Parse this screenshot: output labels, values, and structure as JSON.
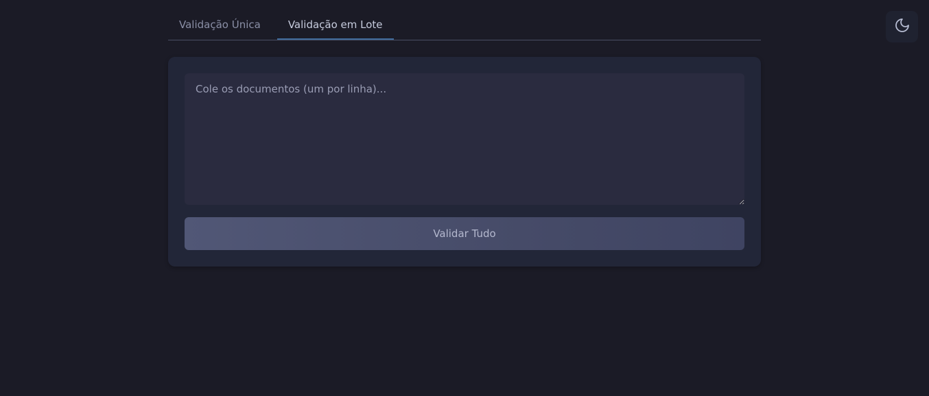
{
  "tabs": [
    {
      "label": "Validação Única",
      "active": false
    },
    {
      "label": "Validação em Lote",
      "active": true
    }
  ],
  "batch": {
    "placeholder": "Cole os documentos (um por linha)...",
    "value": "",
    "button_label": "Validar Tudo"
  },
  "theme_toggle": {
    "icon": "moon-icon"
  },
  "colors": {
    "background": "#1b1b26",
    "card": "#222638",
    "textarea": "#2a2b3f",
    "button": "#4b5170",
    "active_tab_underline": "#3f6b9c"
  }
}
